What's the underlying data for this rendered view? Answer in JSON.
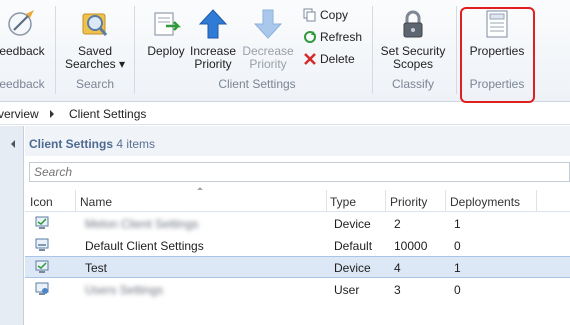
{
  "ribbon": {
    "feedback_label": "eedback",
    "feedback_group": "eedback",
    "saved_searches_label": "Saved\nSearches ▾",
    "saved_searches_line1": "Saved",
    "saved_searches_line2": "Searches ▾",
    "search_group": "Search",
    "deploy_label": "Deploy",
    "increase_line1": "Increase",
    "increase_line2": "Priority",
    "decrease_line1": "Decrease",
    "decrease_line2": "Priority",
    "copy_label": "Copy",
    "refresh_label": "Refresh",
    "delete_label": "Delete",
    "client_settings_group": "Client Settings",
    "security_line1": "Set Security",
    "security_line2": "Scopes",
    "classify_group": "Classify",
    "properties_label": "Properties",
    "properties_group": "Properties"
  },
  "breadcrumb": {
    "item1": "verview",
    "item2": "Client Settings"
  },
  "panel": {
    "title": "Client Settings",
    "count": "4 items"
  },
  "search": {
    "placeholder": "Search"
  },
  "table": {
    "headers": [
      "Icon",
      "Name",
      "Type",
      "Priority",
      "Deployments"
    ],
    "rows": [
      {
        "name": "Melon Client Settings",
        "type": "Device",
        "priority": "2",
        "deployments": "1"
      },
      {
        "name": "Default Client Settings",
        "type": "Default",
        "priority": "10000",
        "deployments": "0"
      },
      {
        "name": "Test",
        "type": "Device",
        "priority": "4",
        "deployments": "1"
      },
      {
        "name": "Users Settings",
        "type": "User",
        "priority": "3",
        "deployments": "0"
      }
    ]
  },
  "colors": {
    "highlight": "#e02020",
    "selected_row": "#dce8f5",
    "panel_title": "#4d6a8f"
  }
}
